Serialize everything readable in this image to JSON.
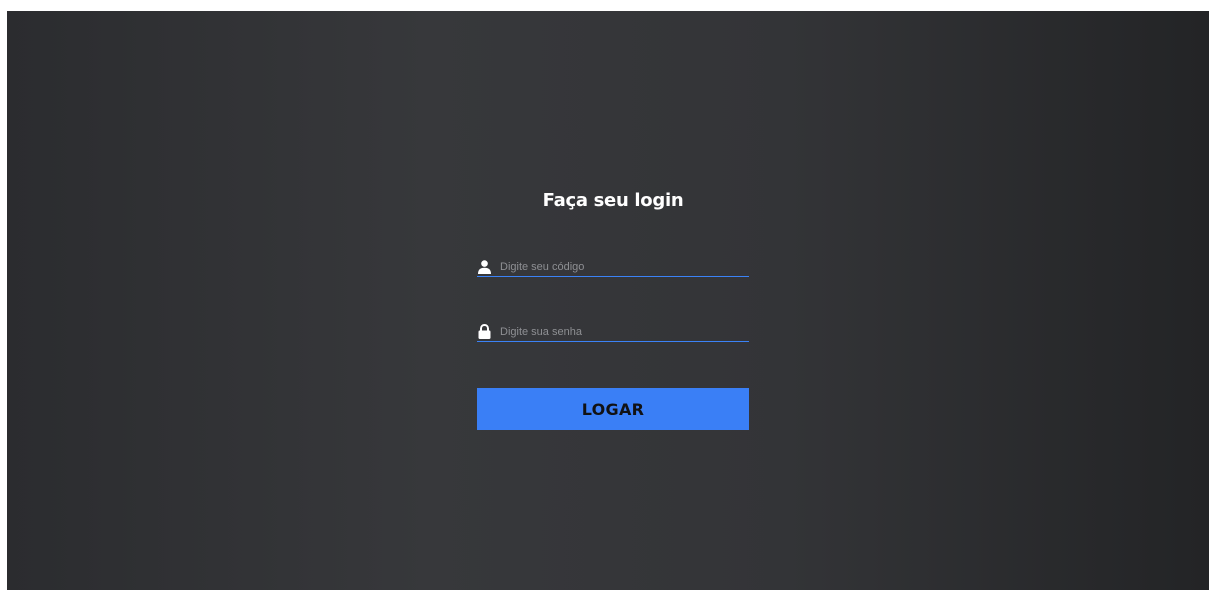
{
  "login": {
    "title": "Faça seu login",
    "code_field": {
      "icon": "user-icon",
      "placeholder": "Digite seu código",
      "value": ""
    },
    "password_field": {
      "icon": "lock-icon",
      "placeholder": "Digite sua senha",
      "value": ""
    },
    "submit_label": "LOGAR"
  },
  "colors": {
    "accent": "#3a7ff6",
    "background_left": "#2b2c2f",
    "background_right": "#232426",
    "title_text": "#ffffff"
  }
}
